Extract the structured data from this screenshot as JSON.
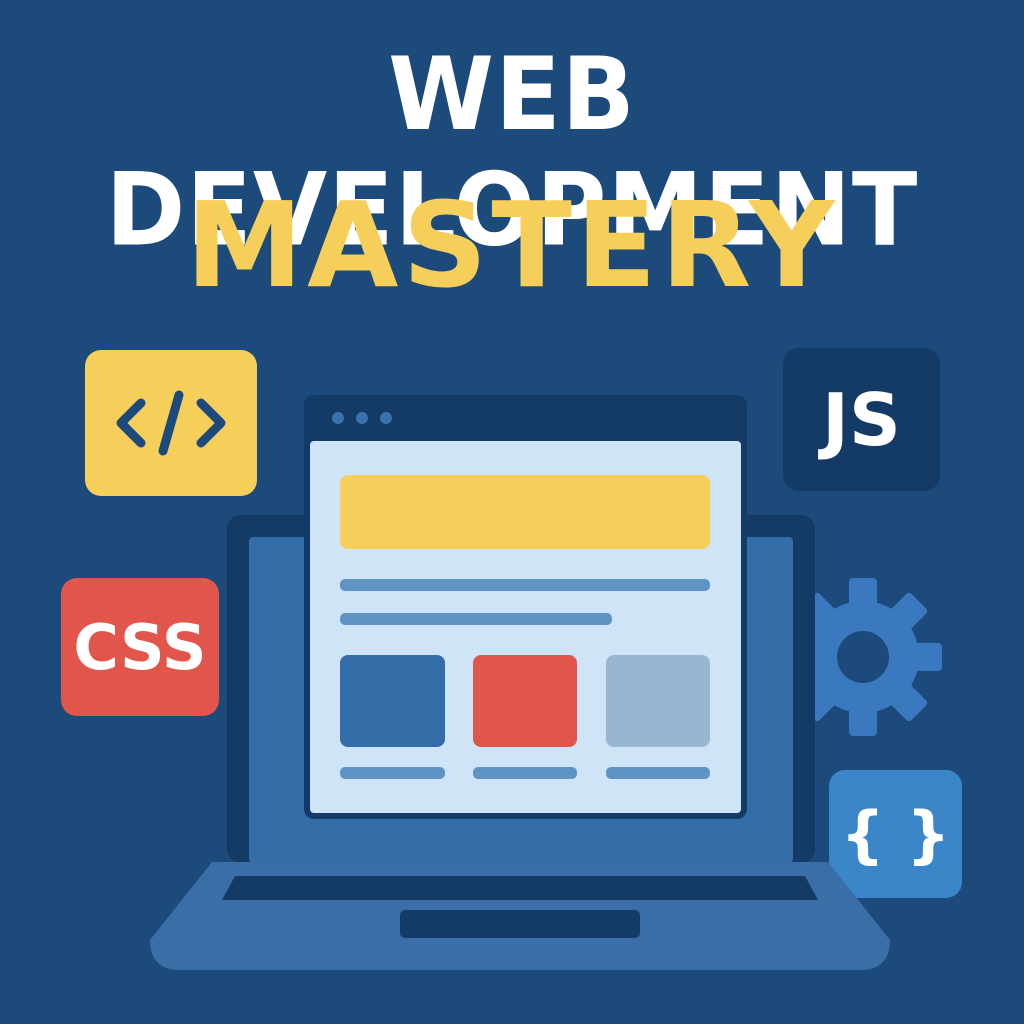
{
  "title": {
    "line1": "WEB DEVELOPMENT",
    "line2": "MASTERY"
  },
  "badges": {
    "code": {
      "icon": "code-tag-icon",
      "text": "</>",
      "color": "#f6cf5b"
    },
    "js": {
      "text": "JS",
      "color": "#143a66"
    },
    "css": {
      "text": "CSS",
      "color": "#e2554b"
    },
    "braces": {
      "text": "{ }",
      "color": "#3a86c9"
    },
    "gear": {
      "icon": "gear-icon",
      "color": "#3a78bf"
    }
  },
  "colors": {
    "background": "#1c4a7b",
    "accent_yellow": "#f6cf5b",
    "accent_red": "#e2554b",
    "accent_blue": "#336ea8",
    "page": "#cfe4f7"
  }
}
